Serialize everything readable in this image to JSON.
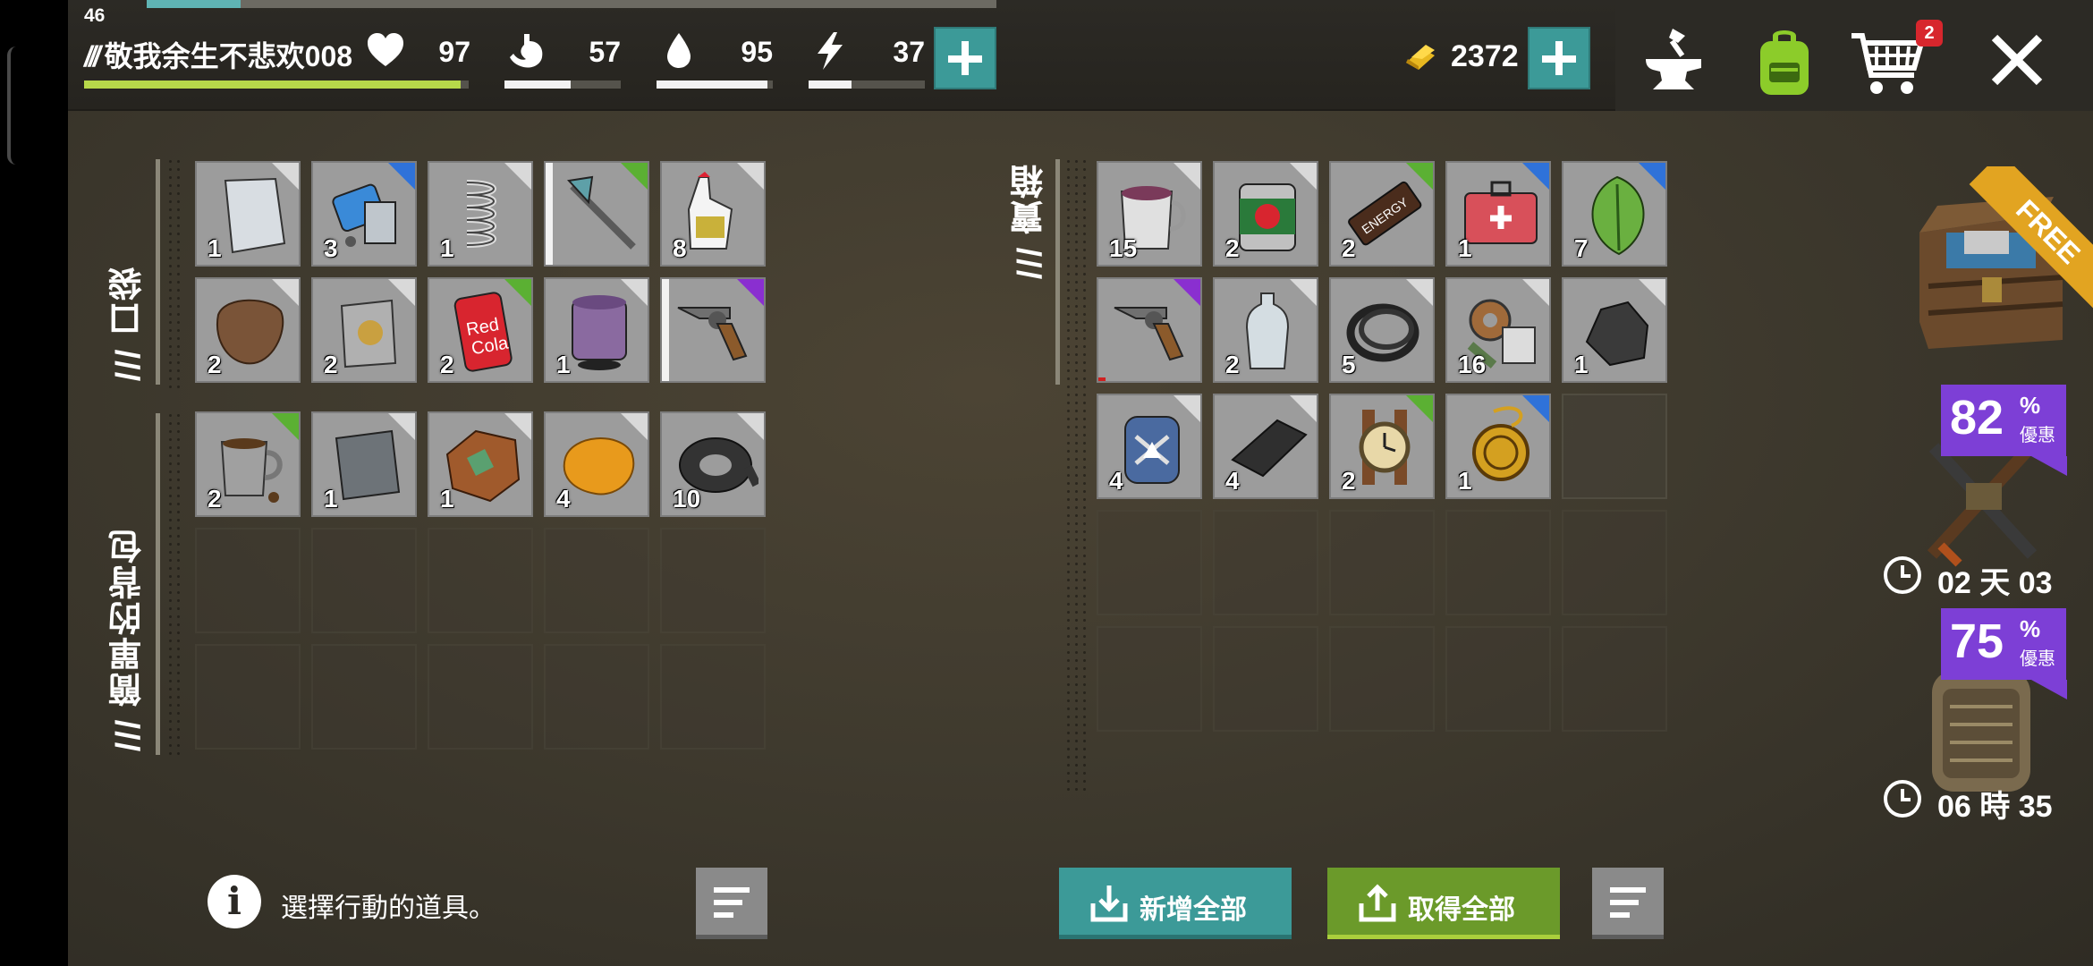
{
  "hud": {
    "level": "46",
    "xp_progress": 0.11,
    "player_name": "敬我余生不悲欢008",
    "name_prefix": "///",
    "hp_progress": 0.98,
    "stats": [
      {
        "name": "health",
        "icon": "heart-icon",
        "value": "97",
        "progress": 0.97
      },
      {
        "name": "food",
        "icon": "stomach-icon",
        "value": "57",
        "progress": 0.57
      },
      {
        "name": "water",
        "icon": "water-drop-icon",
        "value": "95",
        "progress": 0.95
      },
      {
        "name": "energy",
        "icon": "lightning-icon",
        "value": "37",
        "progress": 0.37
      }
    ],
    "gold": "2372",
    "cart_badge": "2"
  },
  "pocket": {
    "label": "/// 口袋",
    "items": [
      {
        "icon": "metal-plate-icon",
        "qty": "1",
        "rarity": "common"
      },
      {
        "icon": "phone-parts-icon",
        "qty": "3",
        "rarity": "rare"
      },
      {
        "icon": "spring-icon",
        "qty": "1",
        "rarity": "common"
      },
      {
        "icon": "axe-icon",
        "qty": "",
        "rarity": "uncommon",
        "durability_stripe": true
      },
      {
        "icon": "glue-icon",
        "qty": "8",
        "rarity": "common"
      },
      {
        "icon": "leather-icon",
        "qty": "2",
        "rarity": "common"
      },
      {
        "icon": "bag-icon",
        "qty": "2",
        "rarity": "common"
      },
      {
        "icon": "soda-can-icon",
        "qty": "2",
        "rarity": "uncommon",
        "label_text": "Red Cola"
      },
      {
        "icon": "paint-can-icon",
        "qty": "1",
        "rarity": "common"
      },
      {
        "icon": "revolver-icon",
        "qty": "",
        "rarity": "epic",
        "durability_stripe": true
      }
    ]
  },
  "backpack": {
    "label": "/// 簡單的背包",
    "items": [
      {
        "icon": "coffee-mug-icon",
        "qty": "2",
        "rarity": "uncommon"
      },
      {
        "icon": "metal-sheet-icon",
        "qty": "1",
        "rarity": "common"
      },
      {
        "icon": "copper-ore-icon",
        "qty": "1",
        "rarity": "common"
      },
      {
        "icon": "resin-icon",
        "qty": "4",
        "rarity": "common"
      },
      {
        "icon": "duct-tape-icon",
        "qty": "10",
        "rarity": "common"
      }
    ]
  },
  "chest": {
    "label": "/// 寶箱",
    "items": [
      {
        "icon": "tea-mug-icon",
        "qty": "15",
        "rarity": "common"
      },
      {
        "icon": "tomato-can-icon",
        "qty": "2",
        "rarity": "common"
      },
      {
        "icon": "energy-bar-icon",
        "qty": "2",
        "rarity": "uncommon",
        "label_text": "ENERGY"
      },
      {
        "icon": "first-aid-kit-icon",
        "qty": "1",
        "rarity": "rare"
      },
      {
        "icon": "leaf-icon",
        "qty": "7",
        "rarity": "rare"
      },
      {
        "icon": "revolver-icon",
        "qty": "",
        "rarity": "epic",
        "broken": true
      },
      {
        "icon": "water-bottle-icon",
        "qty": "2",
        "rarity": "common"
      },
      {
        "icon": "cable-icon",
        "qty": "5",
        "rarity": "common"
      },
      {
        "icon": "scrap-parts-icon",
        "qty": "16",
        "rarity": "common"
      },
      {
        "icon": "coal-icon",
        "qty": "1",
        "rarity": "common"
      },
      {
        "icon": "gas-canister-icon",
        "qty": "4",
        "rarity": "common"
      },
      {
        "icon": "whetstone-icon",
        "qty": "4",
        "rarity": "common"
      },
      {
        "icon": "wristwatch-icon",
        "qty": "2",
        "rarity": "uncommon"
      },
      {
        "icon": "pocket-watch-icon",
        "qty": "1",
        "rarity": "rare"
      }
    ]
  },
  "bottom": {
    "info_text": "選擇行動的道具。",
    "add_all_label": "新增全部",
    "take_all_label": "取得全部"
  },
  "offers": {
    "free_label": "FREE",
    "offer1": {
      "percent": "82",
      "symbol": "%",
      "label": "優惠",
      "timer": "02 天 03"
    },
    "offer2": {
      "percent": "75",
      "symbol": "%",
      "label": "優惠",
      "timer": "06 時 35"
    }
  },
  "colors": {
    "accent_teal": "#3c9a98",
    "accent_green": "#6b9a2a",
    "rarity_rare": "#2f72d9",
    "rarity_uncommon": "#5bb033",
    "rarity_epic": "#8a2fd0",
    "offer_purple": "#7d3fd6",
    "free_orange": "#e2a421"
  }
}
